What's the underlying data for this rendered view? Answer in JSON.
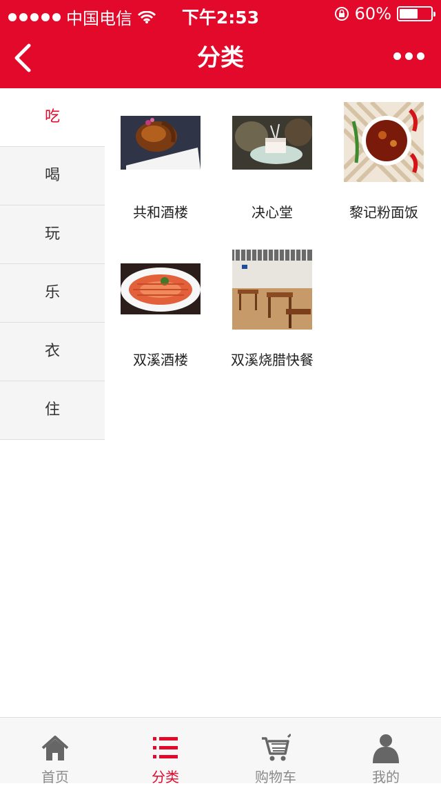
{
  "status_bar": {
    "carrier": "中国电信",
    "time": "下午2:53",
    "battery": "60%",
    "battery_level": 0.6
  },
  "nav": {
    "title": "分类",
    "back_icon": "chevron-left-icon",
    "more_icon": "more-dots-icon"
  },
  "categories": [
    {
      "label": "吃",
      "active": true
    },
    {
      "label": "喝",
      "active": false
    },
    {
      "label": "玩",
      "active": false
    },
    {
      "label": "乐",
      "active": false
    },
    {
      "label": "衣",
      "active": false
    },
    {
      "label": "住",
      "active": false
    }
  ],
  "shops": [
    {
      "name": "共和酒楼",
      "image": "roast-goose-dish"
    },
    {
      "name": "决心堂",
      "image": "dessert-cake-plate"
    },
    {
      "name": "黎记粉面饭",
      "image": "spicy-soup-bowl"
    },
    {
      "name": "双溪酒楼",
      "image": "shrimp-platter"
    },
    {
      "name": "双溪烧腊快餐",
      "image": "restaurant-interior"
    }
  ],
  "tabs": [
    {
      "label": "首页",
      "icon": "home-icon",
      "active": false
    },
    {
      "label": "分类",
      "icon": "category-list-icon",
      "active": true
    },
    {
      "label": "购物车",
      "icon": "cart-icon",
      "active": false
    },
    {
      "label": "我的",
      "icon": "user-icon",
      "active": false
    }
  ],
  "colors": {
    "brand": "#e3092b",
    "inactive": "#8a8a8a",
    "sidebar_bg": "#f5f5f5"
  }
}
